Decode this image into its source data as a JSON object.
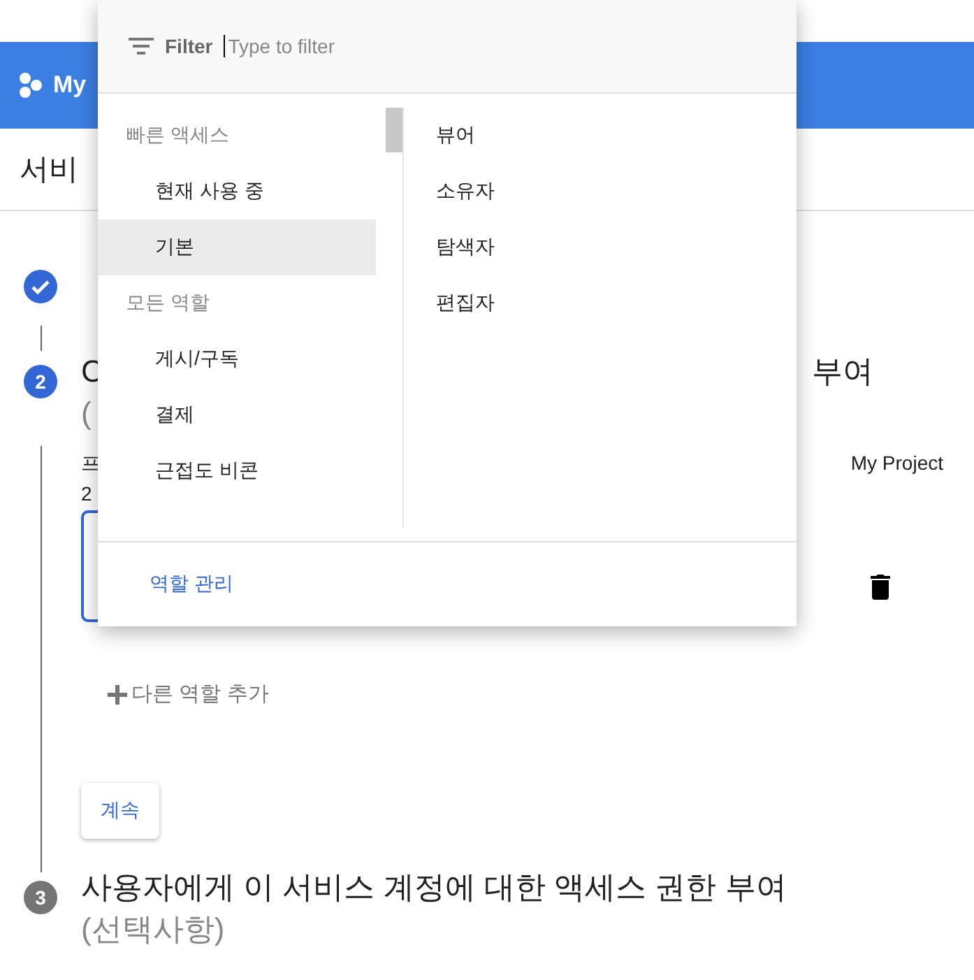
{
  "header": {
    "project": "My"
  },
  "page": {
    "title": "서비"
  },
  "steps": [
    {
      "kind": "done"
    },
    {
      "kind": "active",
      "number": "2",
      "title_left": "C",
      "title_right": "부여",
      "title_line2": "(",
      "desc_left": "프",
      "desc_right": "My Project",
      "desc_line2": "2",
      "add_role": "다른 역할 추가",
      "continue": "계속"
    },
    {
      "kind": "pending",
      "number": "3",
      "title_left": "사용자에게 이 서비스 계정에 대한 액세스 권한 부여",
      "title_line2": "(선택사항)"
    }
  ],
  "role_menu": {
    "filter_label": "Filter",
    "placeholder": "Type to filter",
    "categories": [
      {
        "kind": "header",
        "label": "빠른 액세스"
      },
      {
        "kind": "item",
        "label": "현재 사용 중",
        "selected": false
      },
      {
        "kind": "item",
        "label": "기본",
        "selected": true
      },
      {
        "kind": "header",
        "label": "모든 역할"
      },
      {
        "kind": "item",
        "label": "게시/구독",
        "selected": false
      },
      {
        "kind": "item",
        "label": "결제",
        "selected": false
      },
      {
        "kind": "item",
        "label": "근접도 비콘",
        "selected": false
      }
    ],
    "roles": [
      {
        "label": "뷰어"
      },
      {
        "label": "소유자"
      },
      {
        "label": "탐색자"
      },
      {
        "label": "편집자"
      }
    ],
    "manage_link": "역할 관리"
  }
}
